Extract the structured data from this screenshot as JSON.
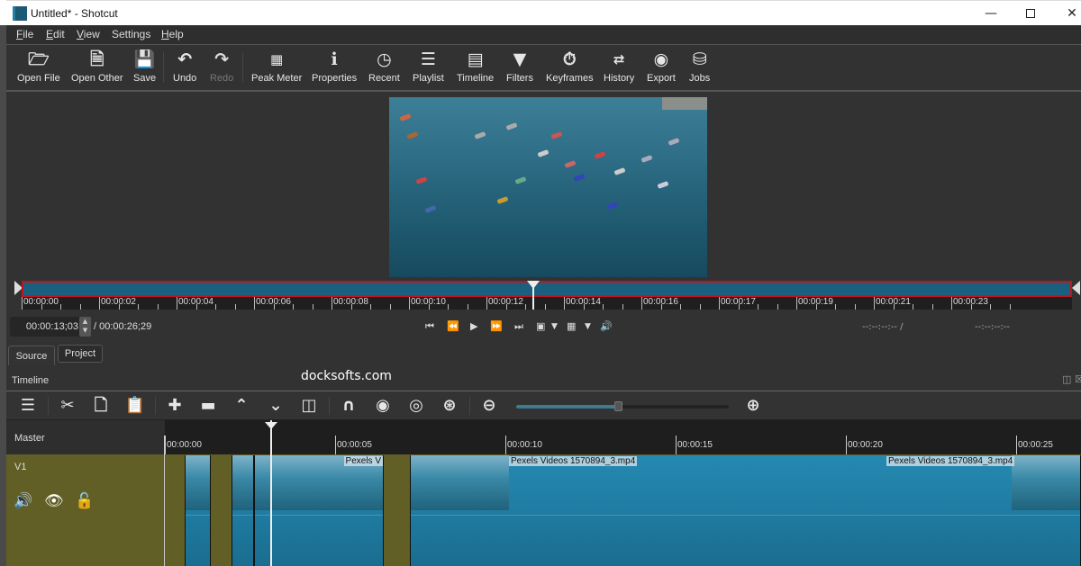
{
  "window": {
    "title": "Untitled* - Shotcut",
    "controls": [
      "minimize",
      "maximize",
      "close"
    ]
  },
  "menu": [
    {
      "label": "File",
      "mnemonic": "F",
      "rest": "ile"
    },
    {
      "label": "Edit",
      "mnemonic": "E",
      "rest": "dit"
    },
    {
      "label": "View",
      "mnemonic": "V",
      "rest": "iew"
    },
    {
      "label": "Settings",
      "mnemonic": "",
      "rest": "Settings"
    },
    {
      "label": "Help",
      "mnemonic": "H",
      "rest": "elp"
    }
  ],
  "toolbar": {
    "open_file": "Open File",
    "open_other": "Open Other",
    "save": "Save",
    "undo": "Undo",
    "redo": "Redo",
    "peak_meter": "Peak Meter",
    "properties": "Properties",
    "recent": "Recent",
    "playlist": "Playlist",
    "timeline": "Timeline",
    "filters": "Filters",
    "keyframes": "Keyframes",
    "history": "History",
    "export": "Export",
    "jobs": "Jobs"
  },
  "player": {
    "ruler_labels": [
      "00:00:00",
      "00:00:02",
      "00:00:04",
      "00:00:06",
      "00:00:08",
      "00:00:10",
      "00:00:12",
      "00:00:14",
      "00:00:16",
      "00:00:17",
      "00:00:19",
      "00:00:21",
      "00:00:23"
    ],
    "position_fraction": 0.487,
    "current_timecode": "00:00:13;03",
    "total_duration": "/ 00:00:26;29",
    "in_point": "--:--:--:-- /",
    "out_point": "--:--:--:--"
  },
  "tabs": {
    "source": "Source",
    "project": "Project"
  },
  "watermark": "docksofts.com",
  "timeline": {
    "title": "Timeline",
    "zoom_level_fraction": 0.48,
    "ruler_labels": [
      "00:00:00",
      "00:00:05",
      "00:00:10",
      "00:00:15",
      "00:00:20",
      "00:00:25"
    ],
    "master_label": "Master",
    "tracks": [
      {
        "name": "V1"
      }
    ],
    "clips": [
      {
        "name": "Pexels V"
      },
      {
        "name": "Pexels Videos 1570894_3.mp4"
      },
      {
        "name": "Pexels Videos 1570894_3.mp4"
      }
    ]
  }
}
